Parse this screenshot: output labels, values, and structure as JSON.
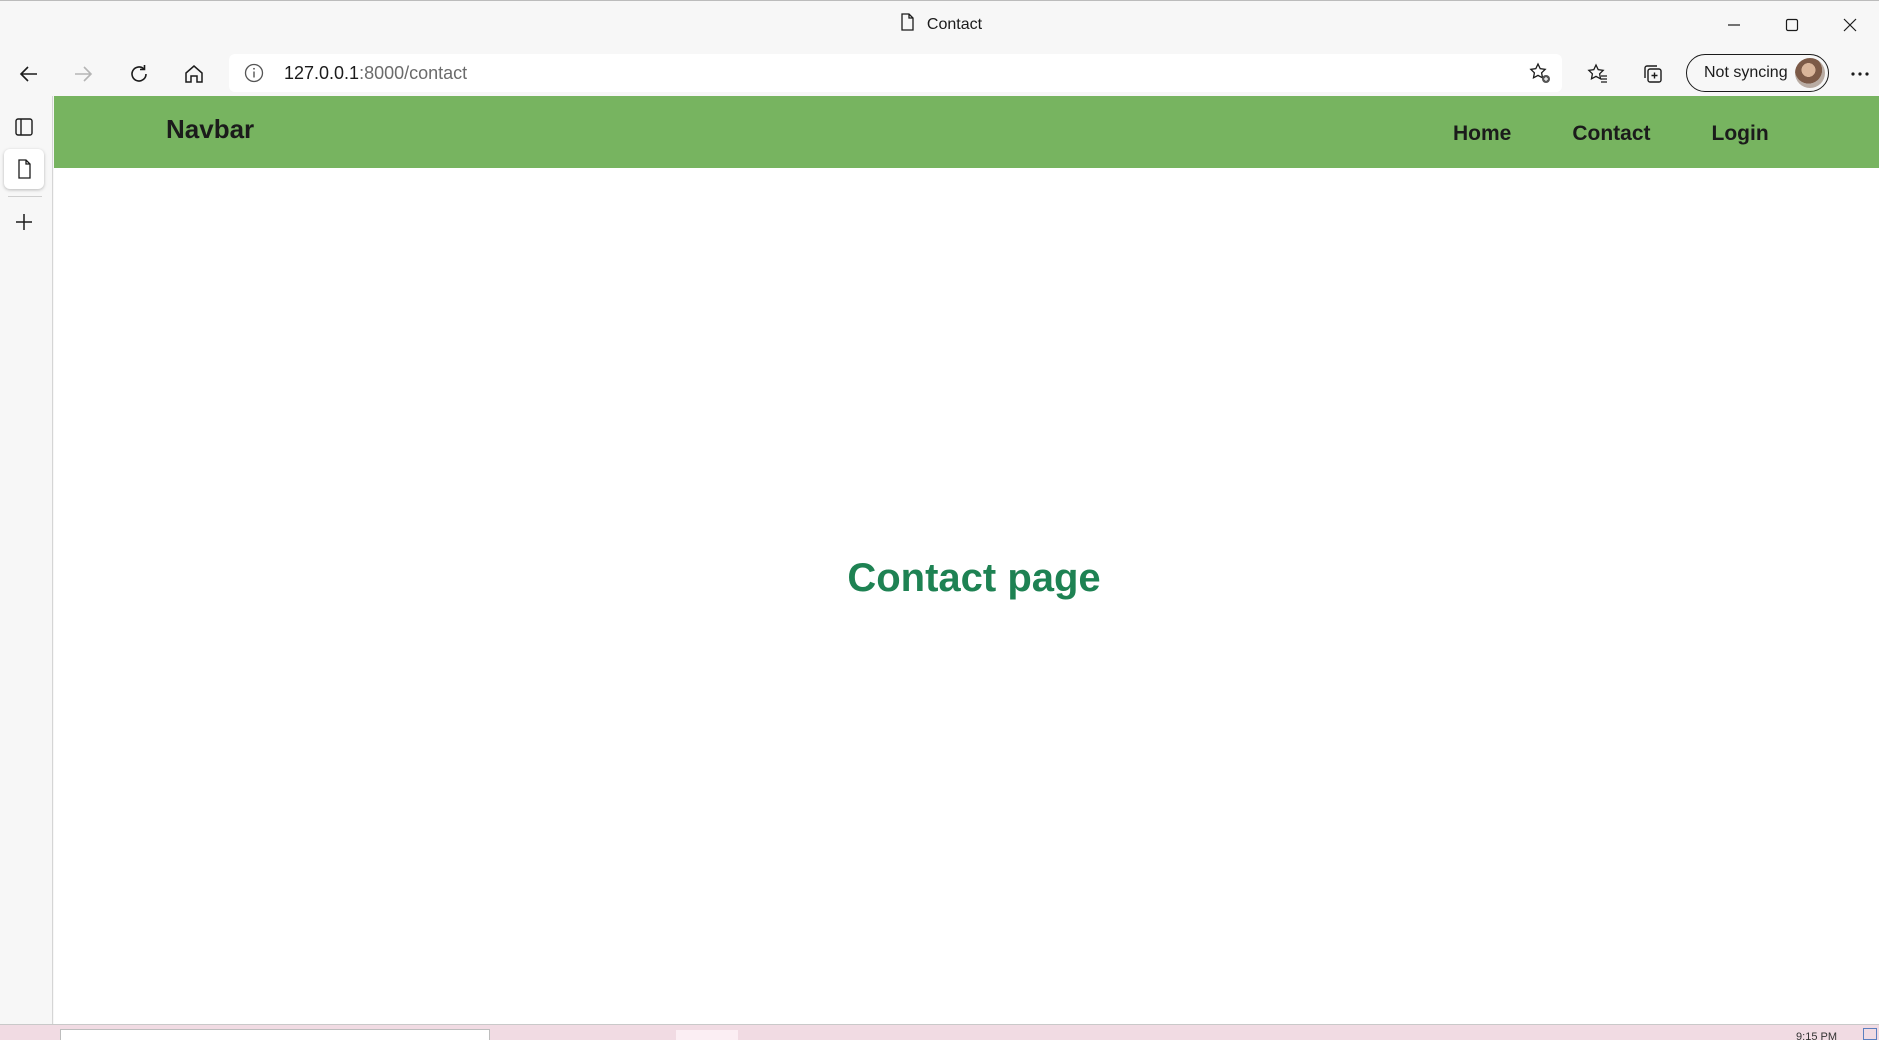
{
  "window": {
    "title": "Contact"
  },
  "toolbar": {
    "url_host": "127.0.0.1",
    "url_path": ":8000/contact",
    "sync_label": "Not syncing"
  },
  "page": {
    "brand": "Navbar",
    "nav": [
      {
        "label": "Home"
      },
      {
        "label": "Contact"
      },
      {
        "label": "Login"
      }
    ],
    "heading": "Contact page"
  },
  "taskbar": {
    "clock": "9:15 PM"
  },
  "colors": {
    "navbar_bg": "#77b460",
    "heading": "#1e8253"
  },
  "icons": [
    "file-icon",
    "minimize-icon",
    "maximize-icon",
    "close-icon",
    "back-icon",
    "forward-icon",
    "refresh-icon",
    "home-icon",
    "info-icon",
    "add-favorite-icon",
    "favorites-icon",
    "collections-icon",
    "more-icon",
    "tab-actions-icon",
    "page-icon",
    "new-tab-icon"
  ]
}
